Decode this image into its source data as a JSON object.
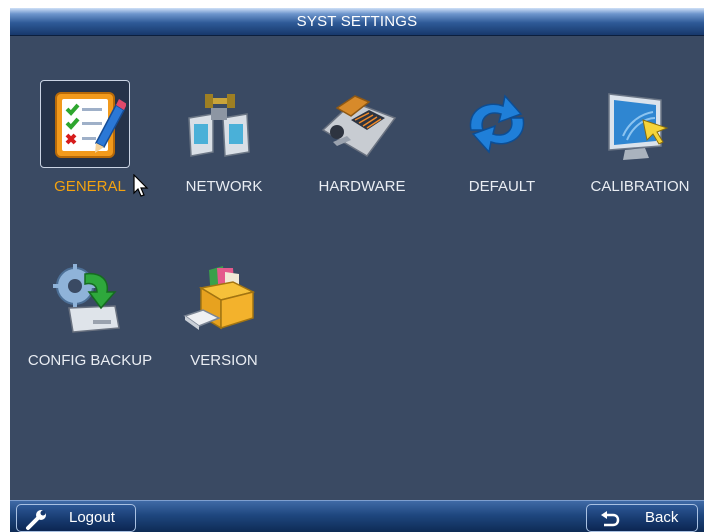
{
  "window": {
    "title": "SYST SETTINGS"
  },
  "menu": {
    "items": [
      {
        "label": "GENERAL",
        "icon": "checklist-pencil-icon",
        "selected": true
      },
      {
        "label": "NETWORK",
        "icon": "network-connector-icon",
        "selected": false
      },
      {
        "label": "HARDWARE",
        "icon": "keyboard-controller-icon",
        "selected": false
      },
      {
        "label": "DEFAULT",
        "icon": "refresh-arrows-icon",
        "selected": false
      },
      {
        "label": "CALIBRATION",
        "icon": "monitor-cursor-icon",
        "selected": false
      },
      {
        "label": "CONFIG BACKUP",
        "icon": "gear-drive-backup-icon",
        "selected": false
      },
      {
        "label": "VERSION",
        "icon": "file-box-icon",
        "selected": false
      }
    ]
  },
  "footer": {
    "logout_label": "Logout",
    "back_label": "Back"
  },
  "colors": {
    "background": "#3a4a63",
    "selected_label": "#f3a20f",
    "label": "#e9edf3",
    "bar_blue": "#1f477f"
  }
}
